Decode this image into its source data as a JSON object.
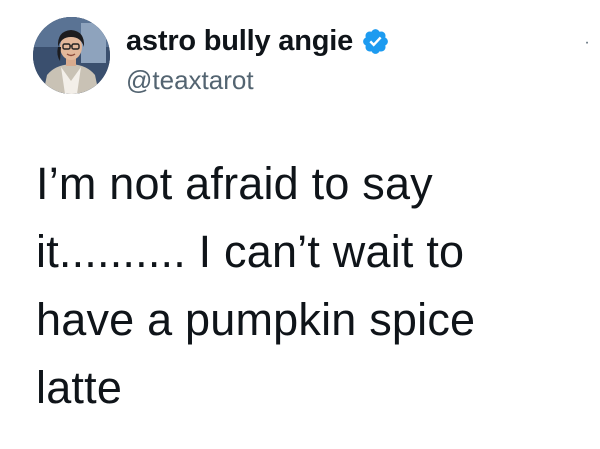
{
  "author": {
    "display_name": "astro bully angie",
    "handle": "@teaxtarot",
    "avatar_icon": "user-avatar",
    "verified_icon": "verified-badge-icon",
    "verified_color": "#1d9bf0"
  },
  "menu": {
    "icon": "more-icon",
    "glyph": "·"
  },
  "tweet": {
    "text": "I’m not afraid to say\nit.......... I can’t wait to\nhave a pumpkin spice\nlatte"
  }
}
